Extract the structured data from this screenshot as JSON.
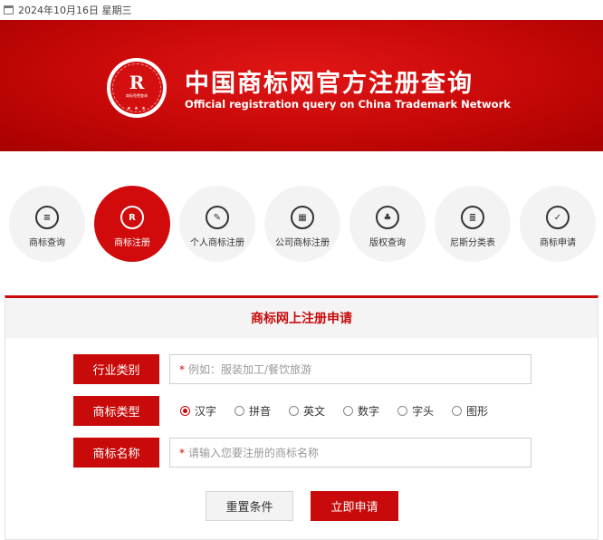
{
  "topbar": {
    "date_text": "2024年10月16日 星期三",
    "icon": "calendar-icon"
  },
  "banner": {
    "title": "中国商标网官方注册查询",
    "subtitle": "Official registration query on China Trademark Network",
    "logo": {
      "letter": "R",
      "ring_text": "商标注册专业查询系统",
      "sub_text": "商标免费查询",
      "stars": "★ ★ ★"
    }
  },
  "nav": {
    "items": [
      {
        "label": "商标查询",
        "icon": "search-doc-icon",
        "glyph": "≡",
        "active": false
      },
      {
        "label": "商标注册",
        "icon": "registered-icon",
        "glyph": "R",
        "active": true
      },
      {
        "label": "个人商标注册",
        "icon": "user-doc-icon",
        "glyph": "✎",
        "active": false
      },
      {
        "label": "公司商标注册",
        "icon": "calendar-doc-icon",
        "glyph": "▦",
        "active": false
      },
      {
        "label": "版权查询",
        "icon": "org-chart-icon",
        "glyph": "♣",
        "active": false
      },
      {
        "label": "尼斯分类表",
        "icon": "list-doc-icon",
        "glyph": "≣",
        "active": false
      },
      {
        "label": "商标申请",
        "icon": "edit-doc-icon",
        "glyph": "✓",
        "active": false
      }
    ]
  },
  "form": {
    "heading": "商标网上注册申请",
    "industry": {
      "label": "行业类别",
      "required_mark": "*",
      "placeholder": "例如：服装加工/餐饮旅游"
    },
    "type": {
      "label": "商标类型",
      "options": [
        "汉字",
        "拼音",
        "英文",
        "数字",
        "字头",
        "图形"
      ],
      "selected": "汉字"
    },
    "name": {
      "label": "商标名称",
      "required_mark": "*",
      "placeholder": "请输入您要注册的商标名称"
    },
    "reset_label": "重置条件",
    "submit_label": "立即申请"
  },
  "colors": {
    "brand_red": "#c80a0a",
    "banner_red": "#d40f0f",
    "nav_bg": "#f3f3f3"
  }
}
